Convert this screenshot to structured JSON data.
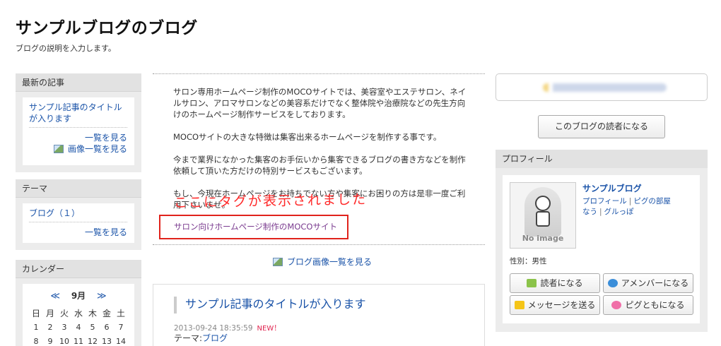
{
  "header": {
    "blog_title": "サンプルブログのブログ",
    "blog_description": "ブログの説明を入力します。"
  },
  "left": {
    "recent": {
      "title": "最新の記事",
      "article_link": "サンプル記事のタイトルが入ります",
      "list_link": "一覧を見る",
      "image_list_link": "画像一覧を見る"
    },
    "theme": {
      "title": "テーマ",
      "item": "ブログ（１）",
      "list_link": "一覧を見る"
    },
    "calendar": {
      "title": "カレンダー",
      "prev": "≪",
      "next": "≫",
      "month": "9月",
      "weekdays": [
        "日",
        "月",
        "火",
        "水",
        "木",
        "金",
        "土"
      ],
      "row1": [
        "1",
        "2",
        "3",
        "4",
        "5",
        "6",
        "7"
      ],
      "row2": [
        "8",
        "9",
        "10",
        "11",
        "12",
        "13",
        "14"
      ]
    }
  },
  "center": {
    "paragraph1": "サロン専用ホームページ制作のMOCOサイトでは、美容室やエステサロン、ネイルサロン、アロマサロンなどの美容系だけでなく整体院や治療院などの先生方向けのホームページ制作サービスをしております。",
    "paragraph2": "MOCOサイトの大きな特徴は集客出来るホームページを制作する事です。",
    "paragraph3": "今まで業界になかった集客のお手伝いから集客できるブログの書き方などを制作依頼して頂いた方だけの特別サービスもございます。",
    "paragraph4": "もし、今現在ホームページをお持ちでない方や集客にお困りの方は是非一度ご利用下さいませ。",
    "annotation": "ここにタグが表示されました",
    "tag_link": "サロン向けホームページ制作のMOCOサイト",
    "image_list_link": "ブログ画像一覧を見る",
    "entry": {
      "title": "サンプル記事のタイトルが入ります",
      "date": "2013-09-24 18:35:59",
      "new_badge": "NEW！",
      "theme_label": "テーマ:",
      "theme_link": "ブログ"
    }
  },
  "right": {
    "reader_button": "このブログの読者になる",
    "profile": {
      "title": "プロフィール",
      "no_image": "No image",
      "name": "サンプルブログ",
      "link_profile": "プロフィール",
      "link_room": "ピグの部屋",
      "link_now": "なう",
      "link_gurupo": "グルっぽ",
      "gender": "性別：男性",
      "btn_reader": "読者になる",
      "btn_amember": "アメンバーになる",
      "btn_message": "メッセージを送る",
      "btn_pigtomo": "ピグともになる"
    }
  }
}
